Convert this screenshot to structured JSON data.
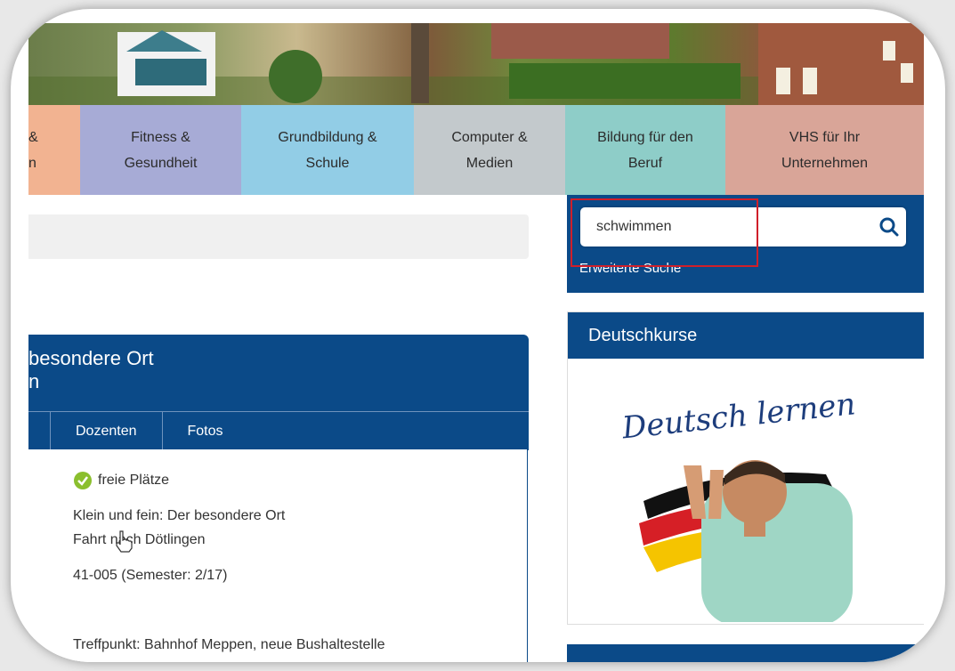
{
  "nav": {
    "tabs": [
      {
        "label1": "&",
        "label2": "n",
        "color": "#f2b391"
      },
      {
        "label1": "Fitness &",
        "label2": "Gesundheit",
        "color": "#a7abd6"
      },
      {
        "label1": "Grundbildung &",
        "label2": "Schule",
        "color": "#92cde6"
      },
      {
        "label1": "Computer &",
        "label2": "Medien",
        "color": "#c3c9cc"
      },
      {
        "label1": "Bildung für den",
        "label2": "Beruf",
        "color": "#8ecdc8"
      },
      {
        "label1": "VHS für Ihr",
        "label2": "Unternehmen",
        "color": "#d9a598"
      }
    ]
  },
  "course": {
    "title_line1": "besondere Ort",
    "title_line2": "n",
    "tabs": [
      "Dozenten",
      "Fotos"
    ],
    "status": "freie Plätze",
    "desc_line1": "Klein und fein: Der besondere Ort",
    "desc_line2": "Fahrt nach Dötlingen",
    "number": "41-005 (Semester: 2/17)",
    "meeting": "Treffpunkt: Bahnhof Meppen, neue Bushaltestelle"
  },
  "search": {
    "value": "schwimmen",
    "advanced_link": "Erweiterte Suche"
  },
  "sidebar": {
    "deutschkurse_title": "Deutschkurse",
    "promo_text": "Deutsch lernen"
  },
  "colors": {
    "primary": "#0b4a88",
    "highlight": "#d01f2a",
    "check": "#8bbf2e"
  }
}
